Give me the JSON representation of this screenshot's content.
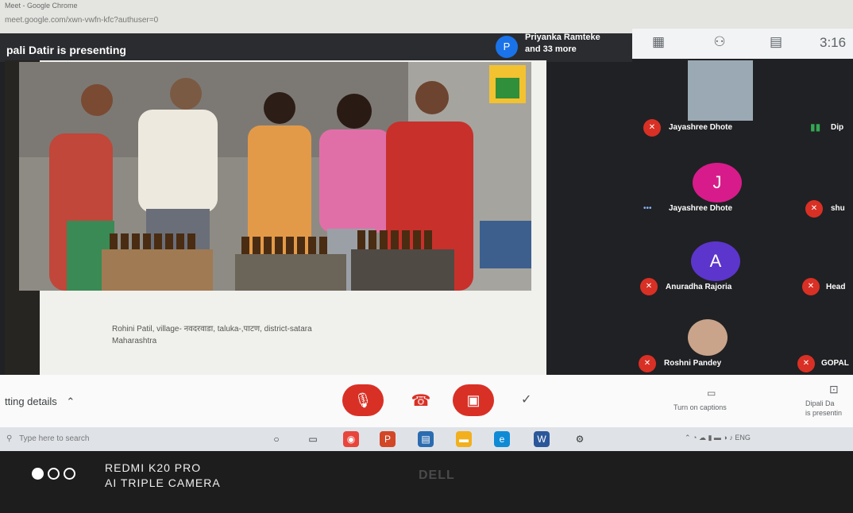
{
  "browser": {
    "title": "Meet - Google Chrome",
    "url": "meet.google.com/xwn-vwfn-kfc?authuser=0"
  },
  "presenting": {
    "text": "pali Datir is presenting",
    "participants_line1": "Priyanka Ramteke",
    "participants_line2": "and 33 more",
    "avatar_letter": "P"
  },
  "top_bar": {
    "time": "3:16",
    "icons": [
      "grid-icon",
      "people-icon",
      "chat-icon"
    ]
  },
  "slide": {
    "caption_line1": "Rohini Patil, village- नवदरवाडा, taluka-,पाटण, district-satara",
    "caption_line2": "Maharashtra"
  },
  "participants": [
    {
      "name": "Jayashree Dhote",
      "muted": true
    },
    {
      "name": "Dip",
      "muted": false
    },
    {
      "name": "Jayashree Dhote",
      "avatar_letter": "J",
      "avatar_color": "#d81b8a",
      "speaking": true
    },
    {
      "name": "shu",
      "muted": true
    },
    {
      "name": "Anuradha Rajoria",
      "avatar_letter": "A",
      "avatar_color": "#5c35cc",
      "muted": true
    },
    {
      "name": "Head",
      "muted": true
    },
    {
      "name": "Roshni Pandey",
      "muted": true
    },
    {
      "name": "GOPAL",
      "muted": true
    }
  ],
  "controls": {
    "meeting_details": "tting details",
    "captions_label": "Turn on captions",
    "present_label_line1": "Dipali Da",
    "present_label_line2": "is presentin"
  },
  "taskbar": {
    "search_placeholder": "Type here to search",
    "tray_text": "ENG"
  },
  "camera_watermark": {
    "line1": "REDMI K20 PRO",
    "line2": "AI TRIPLE CAMERA"
  },
  "monitor_brand": "DELL",
  "colors": {
    "meet_bg": "#202124",
    "mute_red": "#d93025",
    "accent_blue": "#1a73e8"
  }
}
